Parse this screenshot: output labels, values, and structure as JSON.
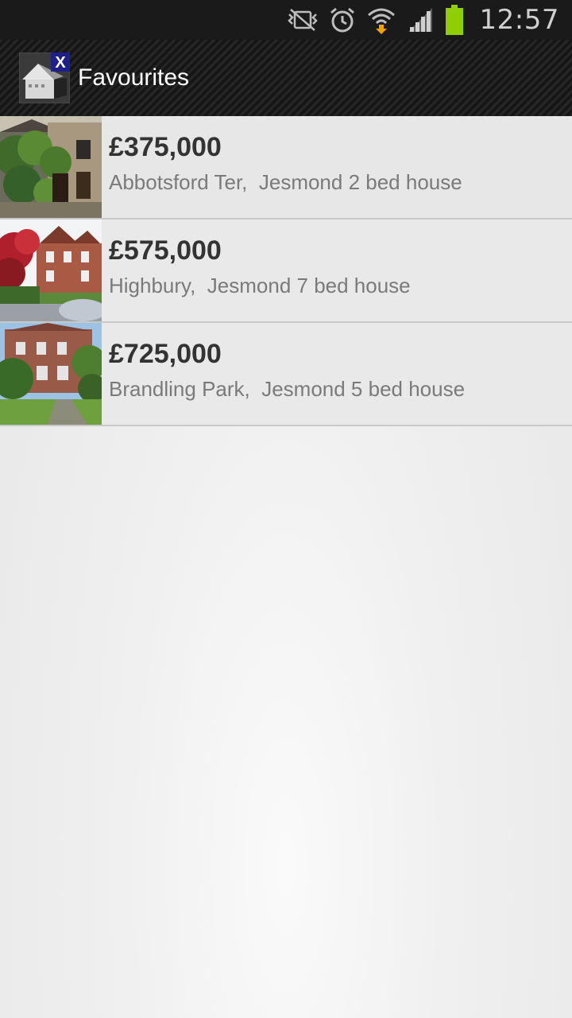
{
  "status_bar": {
    "time": "12:57",
    "icons": [
      "vibrate-mute-icon",
      "alarm-icon",
      "wifi-download-icon",
      "signal-icon",
      "battery-icon"
    ],
    "battery_color": "#8fcf00",
    "download_arrow_color": "#f0a000"
  },
  "action_bar": {
    "title": "Favourites",
    "logo_icon": "house-x-logo-icon",
    "logo_badge": "X"
  },
  "favourites": [
    {
      "price": "£375,000",
      "description": "Abbotsford Ter,  Jesmond 2 bed house",
      "thumbnail": "ivy-covered-terrace-photo"
    },
    {
      "price": "£575,000",
      "description": "Highbury,  Jesmond 7 bed house",
      "thumbnail": "red-brick-villas-photo"
    },
    {
      "price": "£725,000",
      "description": "Brandling Park,  Jesmond 5 bed house",
      "thumbnail": "brick-house-garden-photo"
    }
  ]
}
